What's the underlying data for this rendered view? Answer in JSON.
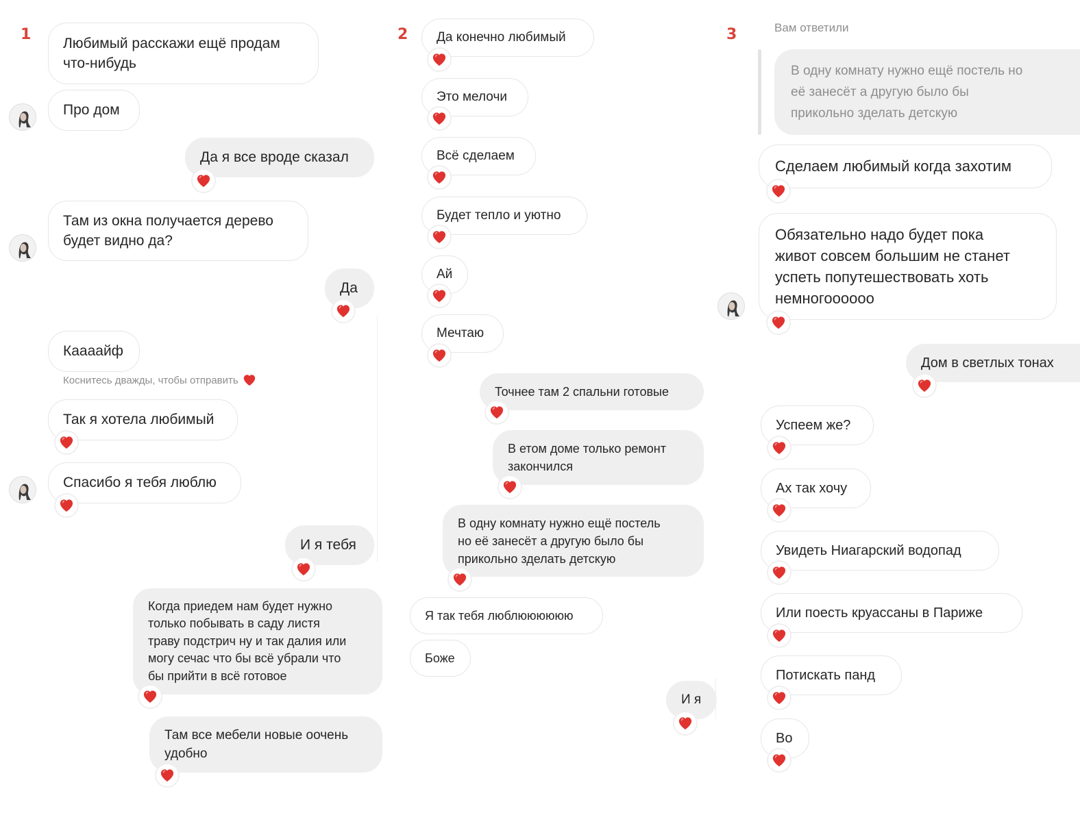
{
  "columns": [
    {
      "number": "1",
      "hint": "Коснитесь дважды, чтобы отправить",
      "messages": [
        {
          "text": "Любимый расскажи ещё продам что-нибудь",
          "lines": [
            "Любимый расскажи ещё продам",
            "что-нибудь"
          ],
          "from": "them",
          "liked": false
        },
        {
          "text": "Про дом",
          "from": "them",
          "liked": false
        },
        {
          "text": "Да я все вроде сказал",
          "from": "me",
          "liked": true
        },
        {
          "text": "Там из окна получается дерево будет видно да?",
          "lines": [
            "Там из окна получается дерево",
            "будет видно да?"
          ],
          "from": "them",
          "liked": false
        },
        {
          "text": "Да",
          "from": "me",
          "liked": true
        },
        {
          "text": "Каааайф",
          "from": "them",
          "liked": false
        },
        {
          "text": "Так я хотела любимый",
          "from": "them",
          "liked": true
        },
        {
          "text": "Спасибо я тебя люблю",
          "from": "them",
          "liked": true
        },
        {
          "text": "И я тебя",
          "from": "me",
          "liked": true
        },
        {
          "text": "Когда приедем нам будет нужно только побывать в саду листя траву подстрич ну и так далия или могу сечас что бы всё убрали что бы прийти в всё готовое",
          "lines": [
            "Когда приедем нам будет нужно",
            "только побывать в саду листя",
            "траву подстрич ну и так далия или",
            "могу сечас что бы всё убрали что",
            "бы прийти в всё готовое"
          ],
          "from": "me",
          "liked": true
        },
        {
          "text": "Там все мебели новые оочень удобно",
          "lines": [
            "Там все мебели новые оочень",
            "удобно"
          ],
          "from": "me",
          "liked": true
        }
      ]
    },
    {
      "number": "2",
      "messages": [
        {
          "text": "Да конечно любимый",
          "from": "them",
          "liked": true
        },
        {
          "text": "Это мелочи",
          "from": "them",
          "liked": true
        },
        {
          "text": "Всё сделаем",
          "from": "them",
          "liked": true
        },
        {
          "text": "Будет тепло и уютно",
          "from": "them",
          "liked": true
        },
        {
          "text": "Ай",
          "from": "them",
          "liked": true
        },
        {
          "text": "Мечтаю",
          "from": "them",
          "liked": true
        },
        {
          "text": "Точнее там 2 спальни готовые",
          "from": "me",
          "liked": true
        },
        {
          "text": "В етом доме только ремонт закончился",
          "lines": [
            "В етом доме только ремонт",
            "закончился"
          ],
          "from": "me",
          "liked": true
        },
        {
          "text": "В одну комнату нужно ещё постель но её занесёт а другую было бы прикольно зделать детскую",
          "lines": [
            "В одну комнату нужно ещё постель",
            "но её занесёт а другую было бы",
            "прикольно зделать детскую"
          ],
          "from": "me",
          "liked": true
        },
        {
          "text": "Я так тебя люблюююююю",
          "from": "them",
          "liked": false
        },
        {
          "text": "Боже",
          "from": "them",
          "liked": false
        },
        {
          "text": "И я",
          "from": "me",
          "liked": true
        }
      ]
    },
    {
      "number": "3",
      "reply_label": "Вам ответили",
      "quoted": {
        "text": "В одну комнату нужно ещё постель но её занесёт а другую было бы прикольно зделать детскую",
        "lines": [
          "В одну комнату нужно ещё постель но",
          "её занесёт а другую было бы",
          "прикольно зделать детскую"
        ]
      },
      "messages": [
        {
          "text": "Сделаем любимый когда захотим",
          "from": "them",
          "liked": true
        },
        {
          "text": "Обязательно надо будет пока живот совсем большим не станет успеть попутешествовать хоть немногоооооо",
          "lines": [
            "Обязательно надо будет пока",
            "живот совсем большим не станет",
            "успеть попутешествовать хоть",
            "немногоооооо"
          ],
          "from": "them",
          "liked": true
        },
        {
          "text": "Дом в светлых тонах",
          "from": "me",
          "liked": true
        },
        {
          "text": "Успеем же?",
          "from": "them",
          "liked": true
        },
        {
          "text": "Ах так хочу",
          "from": "them",
          "liked": true
        },
        {
          "text": "Увидеть Ниагарский водопад",
          "from": "them",
          "liked": true
        },
        {
          "text": "Или поесть круассаны в Париже",
          "from": "them",
          "liked": true
        },
        {
          "text": "Потискать панд",
          "from": "them",
          "liked": true
        },
        {
          "text": "Во",
          "from": "them",
          "liked": true
        }
      ]
    }
  ],
  "icons": {
    "heart": "heart-icon",
    "avatar": "avatar-icon"
  },
  "colors": {
    "heart": "#e0332f",
    "number": "#d9453a",
    "outgoing_bubble": "#efefef",
    "incoming_border": "#e6e6e6",
    "muted_text": "#8e8e8e"
  }
}
